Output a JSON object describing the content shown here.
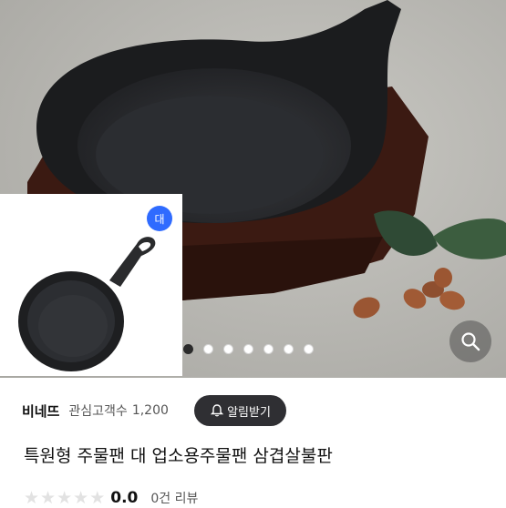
{
  "gallery": {
    "current_index": 1,
    "total": 7,
    "thumb_badge": "대",
    "dots": [
      1,
      2,
      3,
      4,
      5,
      6,
      7
    ]
  },
  "seller": {
    "name": "비네뜨",
    "interest_label": "관심고객수",
    "interest_count": "1,200"
  },
  "alarm_button": {
    "label": "알림받기",
    "plus": "+"
  },
  "product": {
    "title": "특원형 주물팬 대 업소용주물팬 삼겹살불판"
  },
  "rating": {
    "value": "0.0",
    "review_count": "0건 리뷰",
    "stars_filled": 0,
    "stars_total": 5
  },
  "icons": {
    "zoom": "magnifier-icon",
    "bell": "bell-plus-icon"
  },
  "colors": {
    "badge": "#2f6bff",
    "alarm_bg": "#2f2f33"
  }
}
